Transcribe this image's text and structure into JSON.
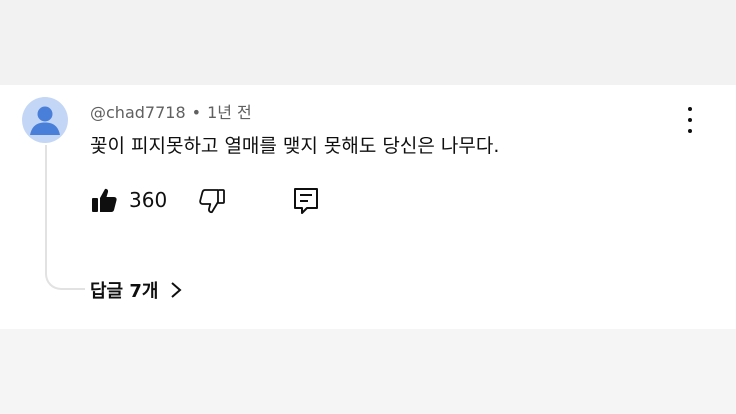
{
  "comment": {
    "author": "@chad7718",
    "separator": "•",
    "time_ago": "1년 전",
    "text": "꽃이 피지못하고 열매를 맺지 못해도 당신은 나무다.",
    "like_count": "360",
    "replies_label": "답글 7개"
  },
  "icons": {
    "avatar": "user-avatar-icon",
    "more": "vertical-ellipsis-icon",
    "like": "thumbs-up-filled-icon",
    "dislike": "thumbs-down-outline-icon",
    "reply": "comment-icon",
    "chevron": "chevron-right-icon"
  },
  "colors": {
    "avatar_bg": "#c3d6f6",
    "avatar_fg": "#4a7fd9",
    "text": "#0f0f0f",
    "meta": "#606060"
  }
}
